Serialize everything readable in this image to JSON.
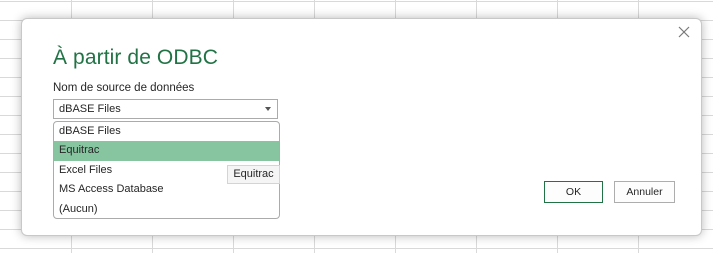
{
  "dialog": {
    "title": "À partir de ODBC",
    "dsn_label": "Nom de source de données",
    "close_icon": "close-icon"
  },
  "dsn_select": {
    "selected": "dBASE Files",
    "options": [
      "dBASE Files",
      "Equitrac",
      "Excel Files",
      "MS Access Database",
      "(Aucun)"
    ],
    "highlighted_option": "Equitrac"
  },
  "tooltip": {
    "text": "Equitrac"
  },
  "buttons": {
    "ok": "OK",
    "cancel": "Annuler"
  },
  "colors": {
    "title": "#217346",
    "highlight": "#86c5a0",
    "grid": "#d9d9d9"
  }
}
